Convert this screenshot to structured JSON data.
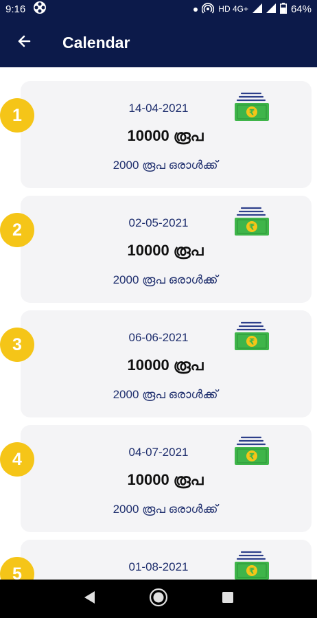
{
  "status_bar": {
    "time": "9:16",
    "network": "HD 4G+",
    "battery": "64%"
  },
  "app_bar": {
    "title": "Calendar"
  },
  "installments": [
    {
      "number": "1",
      "date": "14-04-2021",
      "amount": "10000 രൂപ",
      "per_person": "2000 രൂപ ഒരാൾക്ക്"
    },
    {
      "number": "2",
      "date": "02-05-2021",
      "amount": "10000 രൂപ",
      "per_person": "2000 രൂപ ഒരാൾക്ക്"
    },
    {
      "number": "3",
      "date": "06-06-2021",
      "amount": "10000 രൂപ",
      "per_person": "2000 രൂപ ഒരാൾക്ക്"
    },
    {
      "number": "4",
      "date": "04-07-2021",
      "amount": "10000 രൂപ",
      "per_person": "2000 രൂപ ഒരാൾക്ക്"
    },
    {
      "number": "5",
      "date": "01-08-2021",
      "amount": "",
      "per_person": ""
    }
  ],
  "colors": {
    "app_bar": "#0c1a4a",
    "badge": "#f5c518",
    "card": "#f4f4f6",
    "money_green": "#3fb54a",
    "date_text": "#1f2f6e"
  },
  "icons": {
    "back": "arrow-left-icon",
    "money": "rupee-money-stack-icon",
    "nav_back": "triangle-back-icon",
    "nav_home": "circle-home-icon",
    "nav_recents": "square-recents-icon"
  }
}
